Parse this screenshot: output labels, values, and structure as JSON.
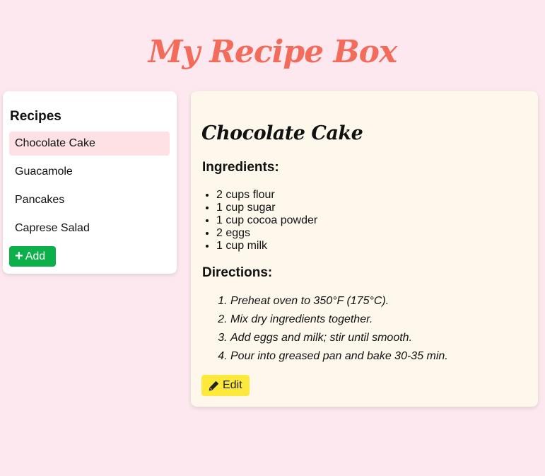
{
  "app": {
    "title": "My Recipe Box"
  },
  "colors": {
    "page_background": "#fde8ef",
    "title_color": "#f26b5b",
    "selected_item_background": "#fde1e4",
    "add_button": "#0bb04a",
    "edit_button": "#fde93c",
    "detail_background": "#fdf7ec"
  },
  "sidebar": {
    "heading": "Recipes",
    "items": [
      {
        "label": "Chocolate Cake",
        "selected": true
      },
      {
        "label": "Guacamole",
        "selected": false
      },
      {
        "label": "Pancakes",
        "selected": false
      },
      {
        "label": "Caprese Salad",
        "selected": false
      }
    ],
    "add_button": {
      "icon": "plus-icon",
      "label": "Add"
    }
  },
  "recipe": {
    "title": "Chocolate Cake",
    "ingredients_heading": "Ingredients:",
    "ingredients": [
      "2 cups flour",
      "1 cup sugar",
      "1 cup cocoa powder",
      "2 eggs",
      "1 cup milk"
    ],
    "directions_heading": "Directions:",
    "directions": [
      "Preheat oven to 350°F (175°C).",
      "Mix dry ingredients together.",
      "Add eggs and milk; stir until smooth.",
      "Pour into greased pan and bake 30-35 min."
    ],
    "edit_button": {
      "icon": "pencil-icon",
      "label": "Edit"
    }
  }
}
